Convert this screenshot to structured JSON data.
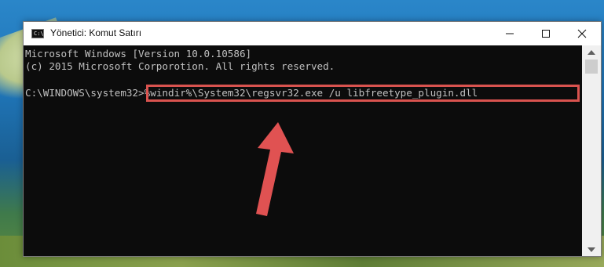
{
  "window": {
    "title": "Yönetici: Komut Satırı",
    "icon": "cmd-icon",
    "icon_text": "C:\\",
    "controls": [
      "minimize-icon",
      "maximize-icon",
      "close-icon"
    ]
  },
  "console": {
    "line1": "Microsoft Windows [Version 10.0.10586]",
    "line2": "(c) 2015 Microsoft Corporotion. All rights reserved.",
    "prompt": "C:\\WINDOWS\\system32>",
    "command": "%windir%\\System32\\regsvr32.exe /u libfreetype_plugin.dll",
    "text_color": "#c0c0c0",
    "background_color": "#0c0c0c"
  },
  "annotation": {
    "highlight_color": "#d9534f",
    "arrow_color": "#e05252"
  }
}
